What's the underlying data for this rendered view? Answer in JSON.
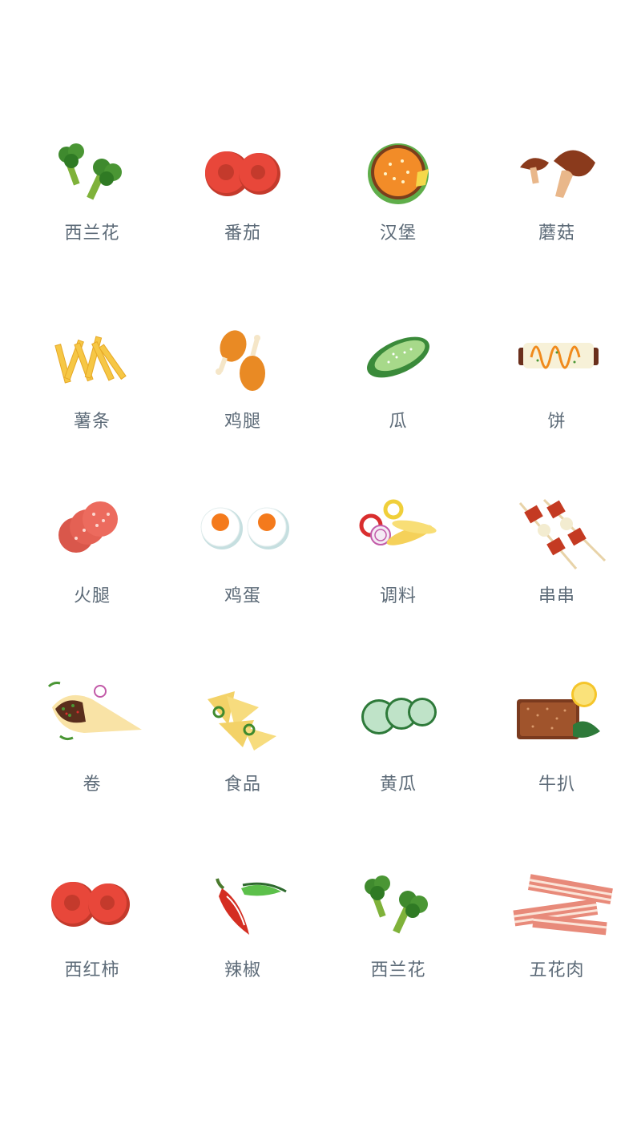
{
  "items": [
    {
      "label": "西兰花",
      "icon": "broccoli-icon"
    },
    {
      "label": "番茄",
      "icon": "tomato-icon"
    },
    {
      "label": "汉堡",
      "icon": "burger-icon"
    },
    {
      "label": "蘑菇",
      "icon": "mushroom-icon"
    },
    {
      "label": "薯条",
      "icon": "fries-icon"
    },
    {
      "label": "鸡腿",
      "icon": "chicken-leg-icon"
    },
    {
      "label": "瓜",
      "icon": "cucumber-whole-icon"
    },
    {
      "label": "饼",
      "icon": "pancake-icon"
    },
    {
      "label": "火腿",
      "icon": "ham-slices-icon"
    },
    {
      "label": "鸡蛋",
      "icon": "egg-icon"
    },
    {
      "label": "调料",
      "icon": "seasoning-icon"
    },
    {
      "label": "串串",
      "icon": "skewer-icon"
    },
    {
      "label": "卷",
      "icon": "wrap-icon"
    },
    {
      "label": "食品",
      "icon": "nachos-icon"
    },
    {
      "label": "黄瓜",
      "icon": "cucumber-slices-icon"
    },
    {
      "label": "牛扒",
      "icon": "steak-icon"
    },
    {
      "label": "西红柿",
      "icon": "tomato-slices-icon"
    },
    {
      "label": "辣椒",
      "icon": "chili-icon"
    },
    {
      "label": "西兰花",
      "icon": "broccoli-icon"
    },
    {
      "label": "五花肉",
      "icon": "bacon-icon"
    }
  ],
  "colors": {
    "label": "#5d6b78",
    "background": "#ffffff"
  }
}
